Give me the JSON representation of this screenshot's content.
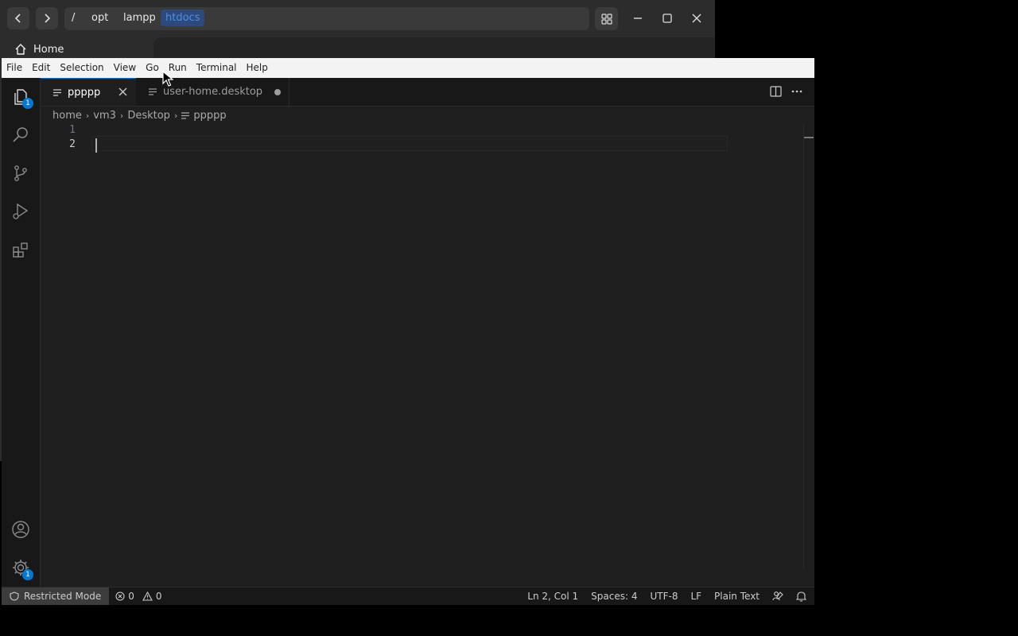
{
  "files_window": {
    "path": [
      "/",
      "opt",
      "lampp",
      "htdocs"
    ],
    "sidebar_home": "Home"
  },
  "menubar": [
    "File",
    "Edit",
    "Selection",
    "View",
    "Go",
    "Run",
    "Terminal",
    "Help"
  ],
  "activity": {
    "explorer_badge": "1",
    "settings_badge": "1"
  },
  "tabs": [
    {
      "label": "ppppp",
      "active": true
    },
    {
      "label": "user-home.desktop",
      "active": false,
      "modified": true
    }
  ],
  "breadcrumb": [
    "home",
    "vm3",
    "Desktop",
    "ppppp"
  ],
  "editor": {
    "line_numbers": [
      "1",
      "2"
    ],
    "current_line": 2
  },
  "statusbar": {
    "restricted": "Restricted Mode",
    "errors": "0",
    "warnings": "0",
    "position": "Ln 2, Col 1",
    "spaces": "Spaces: 4",
    "encoding": "UTF-8",
    "eol": "LF",
    "language": "Plain Text"
  },
  "colors": {
    "accent": "#0078d4",
    "files_active_crumb": "#4d8ee8",
    "folder": "#4a8fe0"
  }
}
